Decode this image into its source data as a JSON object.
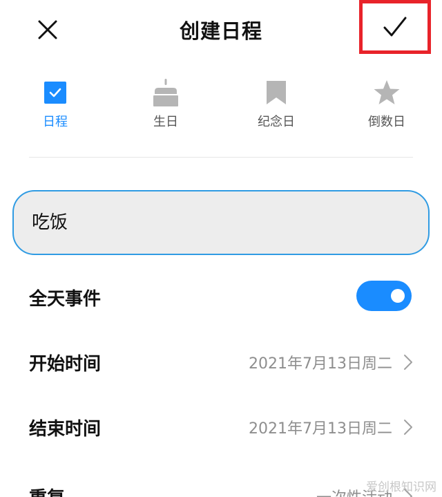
{
  "header": {
    "title": "创建日程",
    "close_icon": "close-icon",
    "confirm_icon": "checkmark-icon",
    "highlight_color": "#e8232a"
  },
  "types": [
    {
      "label": "日程",
      "icon": "checkbox-calendar-icon",
      "active": true
    },
    {
      "label": "生日",
      "icon": "birthday-cake-icon",
      "active": false
    },
    {
      "label": "纪念日",
      "icon": "bookmark-icon",
      "active": false
    },
    {
      "label": "倒数日",
      "icon": "star-icon",
      "active": false
    }
  ],
  "title_input": {
    "value": "吃饭",
    "placeholder": ""
  },
  "all_day": {
    "label": "全天事件",
    "enabled": true
  },
  "start": {
    "label": "开始时间",
    "value": "2021年7月13日周二"
  },
  "end": {
    "label": "结束时间",
    "value": "2021年7月13日周二"
  },
  "repeat": {
    "label": "重复",
    "value": "一次性活动"
  },
  "watermark": "爱创根知识网",
  "colors": {
    "accent": "#1a8cff",
    "inactive_icon": "#b5b5b5",
    "input_border": "#2f9be3"
  }
}
